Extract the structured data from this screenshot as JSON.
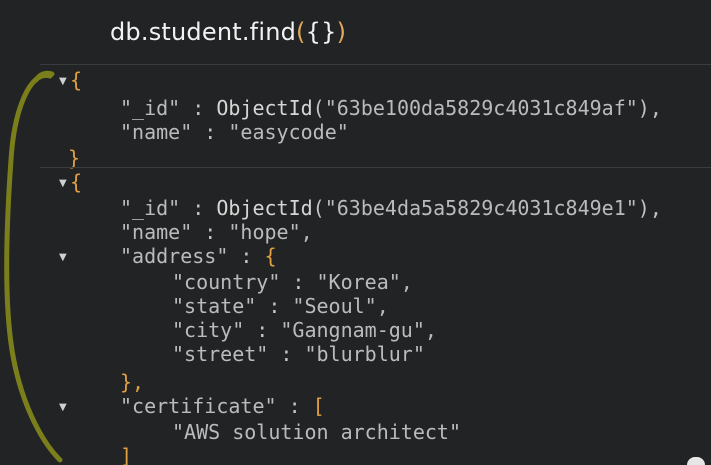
{
  "query": {
    "prefix": "db.student.find",
    "open_paren": "(",
    "braces": "{}",
    "close_paren": ")"
  },
  "doc1": {
    "open": "{",
    "id_key": "\"_id\"",
    "sep": " : ",
    "id_fn": "ObjectId",
    "id_open": "(",
    "id_value": "\"63be100da5829c4031c849af\"",
    "id_close": "),",
    "name_key": "\"name\"",
    "name_value": "\"easycode\"",
    "close": "}"
  },
  "doc2": {
    "open": "{",
    "id_key": "\"_id\"",
    "sep": " : ",
    "id_fn": "ObjectId",
    "id_open": "(",
    "id_value": "\"63be4da5a5829c4031c849e1\"",
    "id_close": "),",
    "name_key": "\"name\"",
    "name_value": "\"hope\",",
    "address_key": "\"address\"",
    "address_open": "{",
    "country_key": "\"country\"",
    "country_value": "\"Korea\",",
    "state_key": "\"state\"",
    "state_value": "\"Seoul\",",
    "city_key": "\"city\"",
    "city_value": "\"Gangnam-gu\",",
    "street_key": "\"street\"",
    "street_value": "\"blurblur\"",
    "address_close": "},",
    "certificate_key": "\"certificate\"",
    "certificate_open": "[",
    "certificate_item": "\"AWS solution architect\"",
    "certificate_close": "]"
  },
  "icons": {
    "collapse": "triangle-down",
    "annotation": "hand-drawn-bracket"
  },
  "colors": {
    "background": "#222324",
    "brace": "#e0a040",
    "text": "#b9bcbf",
    "annotation": "#7a7f1c"
  }
}
